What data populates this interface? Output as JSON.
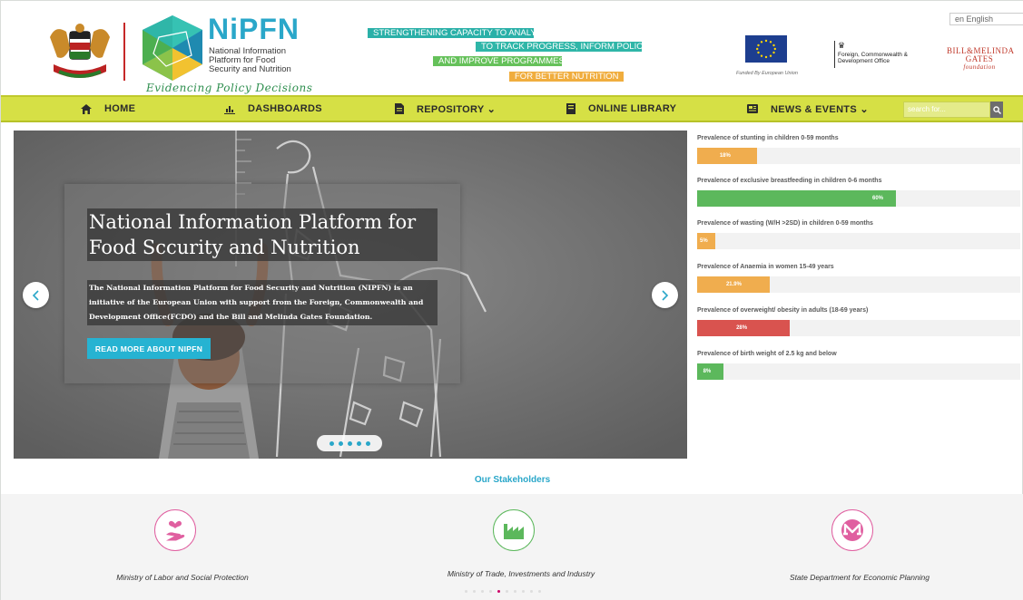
{
  "header": {
    "brand_title": "NiPFN",
    "brand_subtitle": "National Information Platform for Food Security and Nutrition",
    "tagline": "Evidencing Policy Decisions",
    "strips": [
      "STRENGTHENING CAPACITY TO ANALYSE DATA",
      "TO TRACK PROGRESS, INFORM POLICIES",
      "AND IMPROVE PROGRAMMES",
      "FOR BETTER NUTRITION"
    ],
    "eu_caption": "Funded By European Union",
    "fcdo_text": "Foreign, Commonwealth & Development Office",
    "gates_title": "BILL&MELINDA GATES",
    "gates_sub": "foundation",
    "language": "en English"
  },
  "nav": {
    "items": [
      {
        "label": "HOME",
        "icon": "home-icon"
      },
      {
        "label": "DASHBOARDS",
        "icon": "bar-chart-icon"
      },
      {
        "label": "REPOSITORY ⌄",
        "icon": "file-icon"
      },
      {
        "label": "ONLINE LIBRARY",
        "icon": "book-icon"
      },
      {
        "label": "NEWS & EVENTS ⌄",
        "icon": "newspaper-icon"
      }
    ],
    "search_placeholder": "search for...",
    "colors": {
      "nav_bg": "#d6e045"
    }
  },
  "hero": {
    "title": "National Information Platform for Food Sccurity and Nutrition",
    "text": "The National Information Platform for Food Security and Nutrition (NIPFN) is an initiative of the European Union with support from the Foreign, Commonwealth and Development Office(FCDO) and the Bill and Melinda Gates Foundation.",
    "button": "READ MORE ABOUT NIPFN",
    "slide_count": 5
  },
  "indicators": [
    {
      "label": "Prevalence of stunting in children 0-59 months",
      "value": 18,
      "display": "18%",
      "color": "#f0ad4e"
    },
    {
      "label": "Prevalence of exclusive breastfeeding in children 0-6 months",
      "value": 60,
      "display": "60%",
      "color": "#5cb85c"
    },
    {
      "label": "Prevalence of wasting (W/H >2SD) in children 0-59 months",
      "value": 5,
      "display": "5%",
      "color": "#f0ad4e"
    },
    {
      "label": "Prevalence of Anaemia in women 15-49 years",
      "value": 21.9,
      "display": "21.9%",
      "color": "#f0ad4e"
    },
    {
      "label": "Prevalence of overweight/ obesity in adults (18-69 years)",
      "value": 28,
      "display": "28%",
      "color": "#d9534f"
    },
    {
      "label": "Prevalence of birth weight of 2.5 kg and below",
      "value": 8,
      "display": "8%",
      "color": "#5cb85c"
    }
  ],
  "stakeholders": {
    "title": "Our Stakeholders",
    "items": [
      {
        "name": "Ministry of Labor and Social Protection",
        "icon": "hand-heart-icon",
        "color": "#e05fa0"
      },
      {
        "name": "Ministry of Trade, Investments and Industry",
        "icon": "factory-icon",
        "color": "#5cb85c"
      },
      {
        "name": "State Department for Economic Planning",
        "icon": "monero-icon",
        "color": "#e05fa0"
      }
    ],
    "pager_count": 10,
    "pager_active": 4
  }
}
